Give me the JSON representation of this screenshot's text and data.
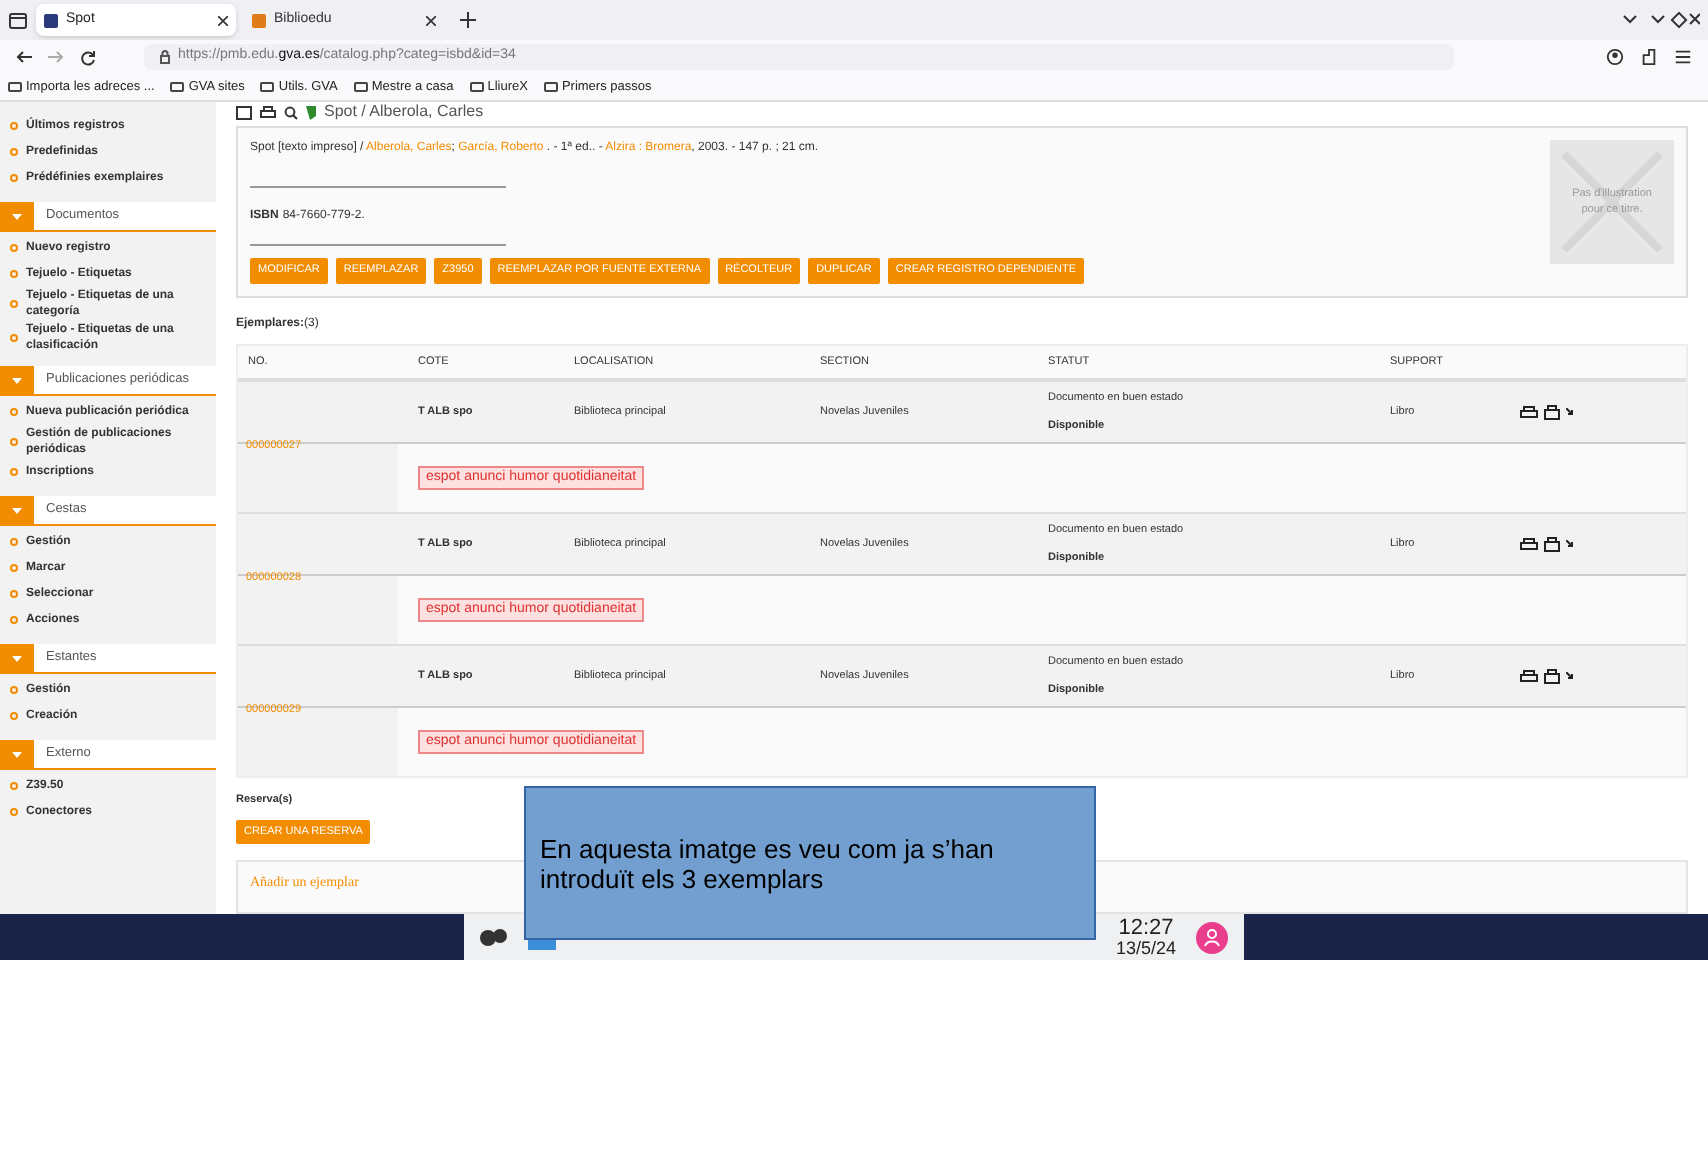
{
  "browser": {
    "tabs": [
      {
        "title": "Spot",
        "selected": true
      },
      {
        "title": "Biblioedu",
        "selected": false
      }
    ],
    "url": {
      "prefix": "https://pmb.edu.",
      "domain": "gva.es",
      "path": "/catalog.php?categ=isbd&id=34"
    },
    "bookmarks": [
      "Importa les adreces ...",
      "GVA sites",
      "Utils. GVA",
      "Mestre a casa",
      "LliureX",
      "Primers passos"
    ]
  },
  "sidebar": {
    "sections": [
      {
        "items": [
          "Últimos registros",
          "Predefinidas",
          "Prédéfinies exemplaires"
        ]
      },
      {
        "title": "Documentos",
        "items": [
          "Nuevo registro",
          "Tejuelo - Etiquetas",
          "Tejuelo - Etiquetas de una categoría",
          "Tejuelo - Etiquetas de una clasificación"
        ]
      },
      {
        "title": "Publicaciones periódicas",
        "items": [
          "Nueva publicación periódica",
          "Gestión de publicaciones periódicas",
          "Inscriptions"
        ]
      },
      {
        "title": "Cestas",
        "items": [
          "Gestión",
          "Marcar",
          "Seleccionar",
          "Acciones"
        ]
      },
      {
        "title": "Estantes",
        "items": [
          "Gestión",
          "Creación"
        ]
      },
      {
        "title": "Externo",
        "items": [
          "Z39.50",
          "Conectores"
        ]
      }
    ]
  },
  "record": {
    "breadcrumb": "Spot / Alberola, Carles",
    "description": [
      {
        "text": "Spot [texto impreso] / ",
        "link": false
      },
      {
        "text": "Alberola, Carles",
        "link": true
      },
      {
        "text": "; ",
        "link": false
      },
      {
        "text": "García, Roberto",
        "link": true
      },
      {
        "text": " . - 1ª ed.. - ",
        "link": false
      },
      {
        "text": "Alzira : Bromera",
        "link": true
      },
      {
        "text": ", 2003. - 147 p. ; 21 cm.",
        "link": false
      }
    ],
    "isbn_label": "ISBN",
    "isbn": "84-7660-779-2.",
    "cover_text": "Pas d'illustration pour ce titre.",
    "buttons": [
      "MODIFICAR",
      "REEMPLAZAR",
      "Z3950",
      "REEMPLAZAR POR FUENTE EXTERNA",
      "RÉCOLTEUR",
      "DUPLICAR",
      "CREAR REGISTRO DEPENDIENTE"
    ]
  },
  "copies": {
    "label": "Ejemplares:",
    "count": "(3)",
    "columns": [
      "NO.",
      "COTE",
      "LOCALISATION",
      "SECTION",
      "STATUT",
      "SUPPORT"
    ],
    "rows": [
      {
        "no": "000000027",
        "cote": "T ALB spo",
        "localisation": "Biblioteca principal",
        "section": "Novelas Juveniles",
        "state": "Documento en buen estado",
        "availability": "Disponible",
        "support": "Libro",
        "tag": "espot anunci humor quotidianeitat"
      },
      {
        "no": "000000028",
        "cote": "T ALB spo",
        "localisation": "Biblioteca principal",
        "section": "Novelas Juveniles",
        "state": "Documento en buen estado",
        "availability": "Disponible",
        "support": "Libro",
        "tag": "espot anunci humor quotidianeitat"
      },
      {
        "no": "000000029",
        "cote": "T ALB spo",
        "localisation": "Biblioteca principal",
        "section": "Novelas Juveniles",
        "state": "Documento en buen estado",
        "availability": "Disponible",
        "support": "Libro",
        "tag": "espot anunci humor quotidianeitat"
      }
    ]
  },
  "reservations": {
    "label": "Reserva(s)",
    "button": "CREAR UNA RESERVA"
  },
  "add_copy": {
    "title": "Añadir un ejemplar"
  },
  "annotation": "En aquesta imatge es veu com ja s’han introduït els 3 exemplars",
  "taskbar": {
    "time": "12:27",
    "date": "13/5/24"
  }
}
